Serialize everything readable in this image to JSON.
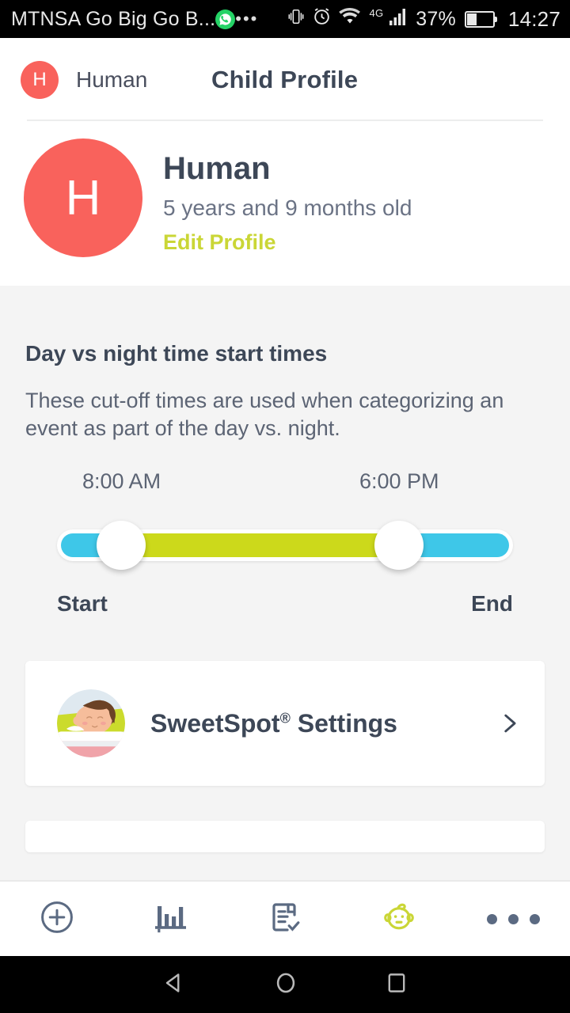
{
  "statusbar": {
    "carrier": "MTNSA Go Big Go B...",
    "whatsapp_icon": "whatsapp-icon",
    "overflow_dots": "•••",
    "vibrate_icon": "vibrate-icon",
    "alarm_icon": "alarm-clock-icon",
    "wifi_icon": "wifi-icon",
    "network_type": "4G",
    "signal_icon": "signal-bars-icon",
    "battery_percent": "37%",
    "battery_icon": "battery-icon",
    "time": "14:27"
  },
  "appbar": {
    "mini_avatar_initial": "H",
    "mini_name": "Human",
    "title": "Child Profile"
  },
  "profile": {
    "avatar_initial": "H",
    "name": "Human",
    "age": "5 years and 9 months old",
    "edit_link": "Edit Profile"
  },
  "section": {
    "title": "Day vs night time start times",
    "description": "These cut-off times are used when categorizing an event as part of the day vs. night."
  },
  "slider": {
    "start_time": "8:00 AM",
    "end_time": "6:00 PM",
    "start_label": "Start",
    "end_label": "End",
    "start_percent": 14,
    "end_percent": 75
  },
  "settings_rows": [
    {
      "icon": "sleeping-child-icon",
      "label_main": "SweetSpot",
      "label_sup": "®",
      "label_tail": " Settings",
      "chevron": "chevron-right-icon"
    }
  ],
  "tabbar": {
    "items": [
      {
        "icon": "add-circle-icon",
        "name": "tab-add"
      },
      {
        "icon": "bar-chart-icon",
        "name": "tab-stats"
      },
      {
        "icon": "checklist-icon",
        "name": "tab-log"
      },
      {
        "icon": "baby-face-icon",
        "name": "tab-child"
      },
      {
        "icon": "more-dots-icon",
        "name": "tab-more"
      }
    ],
    "active_index": 3
  },
  "navbar": {
    "back": "back-triangle-icon",
    "home": "home-circle-icon",
    "recents": "recents-square-icon"
  },
  "colors": {
    "accent_red": "#f9625c",
    "accent_lime": "#ccd91b",
    "accent_cyan": "#3ec7e8",
    "text_dark": "#3d4757",
    "text_muted": "#6b7385",
    "page_bg": "#f4f4f4",
    "card_bg": "#ffffff"
  }
}
